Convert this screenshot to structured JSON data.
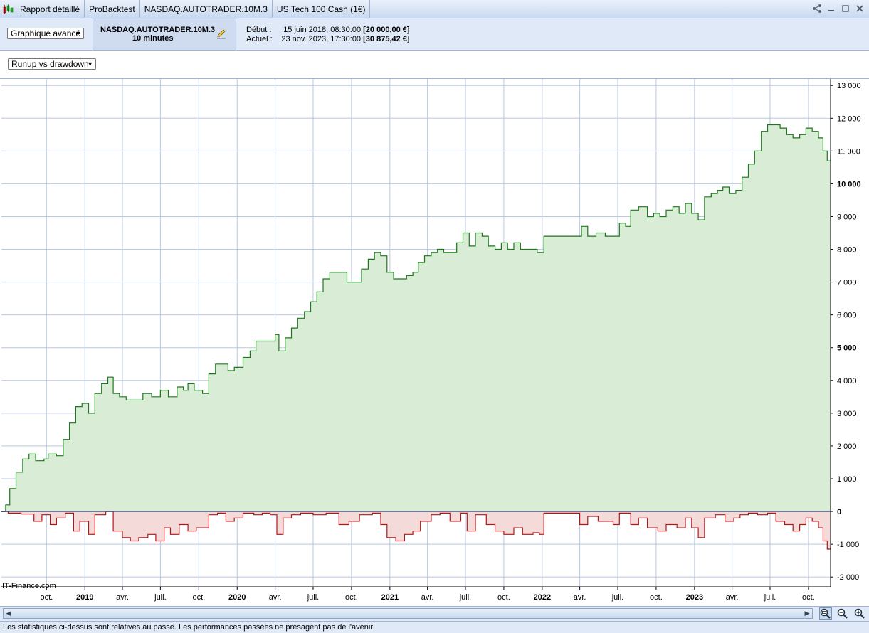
{
  "tabs": [
    "Rapport détaillé",
    "ProBacktest",
    "NASDAQ.AUTOTRADER.10M.3",
    "US Tech 100 Cash (1€)"
  ],
  "header": {
    "view_select": "Graphique avancé",
    "system_name": "NASDAQ.AUTOTRADER.10M.3",
    "timeframe": "10 minutes",
    "start_label": "Début :",
    "start_date": "15 juin 2018, 08:30:00",
    "start_capital": "[20 000,00 €]",
    "current_label": "Actuel :",
    "current_date": "23 nov. 2023, 17:30:00",
    "current_capital": "[30 875,42 €]"
  },
  "chart_select": "Runup vs drawdown",
  "watermark": "IT-Finance.com",
  "status_text": "Les statistiques ci-dessus sont relatives au passé. Les performances passées ne présagent pas de l'avenir.",
  "chart_data": {
    "type": "area",
    "xlabel": "",
    "ylabel": "",
    "ylim": [
      -2300,
      13200
    ],
    "yticks": [
      {
        "v": 13000,
        "label": "13 000",
        "bold": false
      },
      {
        "v": 12000,
        "label": "12 000",
        "bold": false
      },
      {
        "v": 11000,
        "label": "11 000",
        "bold": false
      },
      {
        "v": 10000,
        "label": "10 000",
        "bold": true
      },
      {
        "v": 9000,
        "label": "9 000",
        "bold": false
      },
      {
        "v": 8000,
        "label": "8 000",
        "bold": false
      },
      {
        "v": 7000,
        "label": "7 000",
        "bold": false
      },
      {
        "v": 6000,
        "label": "6 000",
        "bold": false
      },
      {
        "v": 5000,
        "label": "5 000",
        "bold": true
      },
      {
        "v": 4000,
        "label": "4 000",
        "bold": false
      },
      {
        "v": 3000,
        "label": "3 000",
        "bold": false
      },
      {
        "v": 2000,
        "label": "2 000",
        "bold": false
      },
      {
        "v": 1000,
        "label": "1 000",
        "bold": false
      },
      {
        "v": 0,
        "label": "0",
        "bold": true
      },
      {
        "v": -1000,
        "label": "-1 000",
        "bold": false
      },
      {
        "v": -2000,
        "label": "-2 000",
        "bold": false
      }
    ],
    "xrange": [
      "2018-06-15",
      "2023-11-23"
    ],
    "xticks": [
      {
        "d": "2018-10-01",
        "label": "oct.",
        "bold": false
      },
      {
        "d": "2019-01-01",
        "label": "2019",
        "bold": true
      },
      {
        "d": "2019-04-01",
        "label": "avr.",
        "bold": false
      },
      {
        "d": "2019-07-01",
        "label": "juil.",
        "bold": false
      },
      {
        "d": "2019-10-01",
        "label": "oct.",
        "bold": false
      },
      {
        "d": "2020-01-01",
        "label": "2020",
        "bold": true
      },
      {
        "d": "2020-04-01",
        "label": "avr.",
        "bold": false
      },
      {
        "d": "2020-07-01",
        "label": "juil.",
        "bold": false
      },
      {
        "d": "2020-10-01",
        "label": "oct.",
        "bold": false
      },
      {
        "d": "2021-01-01",
        "label": "2021",
        "bold": true
      },
      {
        "d": "2021-04-01",
        "label": "avr.",
        "bold": false
      },
      {
        "d": "2021-07-01",
        "label": "juil.",
        "bold": false
      },
      {
        "d": "2021-10-01",
        "label": "oct.",
        "bold": false
      },
      {
        "d": "2022-01-01",
        "label": "2022",
        "bold": true
      },
      {
        "d": "2022-04-01",
        "label": "avr.",
        "bold": false
      },
      {
        "d": "2022-07-01",
        "label": "juil.",
        "bold": false
      },
      {
        "d": "2022-10-01",
        "label": "oct.",
        "bold": false
      },
      {
        "d": "2023-01-01",
        "label": "2023",
        "bold": true
      },
      {
        "d": "2023-04-01",
        "label": "avr.",
        "bold": false
      },
      {
        "d": "2023-07-01",
        "label": "juil.",
        "bold": false
      },
      {
        "d": "2023-10-01",
        "label": "oct.",
        "bold": false
      }
    ],
    "grid": true,
    "colors": {
      "runup_line": "#1a7a1a",
      "runup_fill": "#d8ecd6",
      "drawdown_line": "#b01818",
      "drawdown_fill": "#f5dada",
      "grid": "#b8c8e0"
    },
    "series": [
      {
        "key": "runup",
        "points": [
          [
            "2018-06-15",
            0
          ],
          [
            "2018-06-25",
            200
          ],
          [
            "2018-07-05",
            700
          ],
          [
            "2018-07-20",
            1200
          ],
          [
            "2018-08-05",
            1600
          ],
          [
            "2018-08-20",
            1750
          ],
          [
            "2018-09-05",
            1550
          ],
          [
            "2018-09-25",
            1600
          ],
          [
            "2018-10-05",
            1750
          ],
          [
            "2018-10-25",
            1700
          ],
          [
            "2018-11-10",
            2200
          ],
          [
            "2018-11-25",
            2700
          ],
          [
            "2018-12-10",
            3200
          ],
          [
            "2018-12-25",
            3300
          ],
          [
            "2019-01-10",
            3000
          ],
          [
            "2019-01-25",
            3600
          ],
          [
            "2019-02-10",
            3900
          ],
          [
            "2019-02-25",
            4100
          ],
          [
            "2019-03-10",
            3600
          ],
          [
            "2019-03-25",
            3500
          ],
          [
            "2019-04-10",
            3400
          ],
          [
            "2019-05-01",
            3400
          ],
          [
            "2019-05-20",
            3600
          ],
          [
            "2019-06-10",
            3500
          ],
          [
            "2019-07-01",
            3700
          ],
          [
            "2019-07-20",
            3500
          ],
          [
            "2019-08-10",
            3800
          ],
          [
            "2019-08-25",
            3700
          ],
          [
            "2019-09-05",
            3900
          ],
          [
            "2019-09-20",
            3700
          ],
          [
            "2019-10-10",
            3600
          ],
          [
            "2019-10-25",
            4200
          ],
          [
            "2019-11-10",
            4500
          ],
          [
            "2019-11-25",
            4500
          ],
          [
            "2019-12-10",
            4300
          ],
          [
            "2019-12-25",
            4400
          ],
          [
            "2020-01-15",
            4700
          ],
          [
            "2020-02-01",
            4900
          ],
          [
            "2020-02-15",
            5200
          ],
          [
            "2020-03-05",
            5200
          ],
          [
            "2020-03-25",
            5200
          ],
          [
            "2020-04-01",
            5400
          ],
          [
            "2020-04-10",
            4900
          ],
          [
            "2020-04-25",
            5300
          ],
          [
            "2020-05-10",
            5600
          ],
          [
            "2020-05-25",
            5900
          ],
          [
            "2020-06-10",
            6100
          ],
          [
            "2020-06-25",
            6400
          ],
          [
            "2020-07-10",
            6700
          ],
          [
            "2020-07-25",
            7100
          ],
          [
            "2020-08-10",
            7300
          ],
          [
            "2020-09-01",
            7300
          ],
          [
            "2020-09-20",
            7000
          ],
          [
            "2020-10-10",
            7000
          ],
          [
            "2020-10-25",
            7400
          ],
          [
            "2020-11-10",
            7700
          ],
          [
            "2020-11-25",
            7900
          ],
          [
            "2020-12-10",
            7800
          ],
          [
            "2020-12-25",
            7300
          ],
          [
            "2021-01-10",
            7100
          ],
          [
            "2021-01-25",
            7100
          ],
          [
            "2021-02-10",
            7200
          ],
          [
            "2021-02-25",
            7300
          ],
          [
            "2021-03-10",
            7600
          ],
          [
            "2021-03-25",
            7800
          ],
          [
            "2021-04-10",
            7900
          ],
          [
            "2021-04-25",
            8000
          ],
          [
            "2021-05-10",
            7900
          ],
          [
            "2021-05-25",
            7900
          ],
          [
            "2021-06-10",
            8200
          ],
          [
            "2021-06-25",
            8500
          ],
          [
            "2021-07-10",
            8100
          ],
          [
            "2021-07-25",
            8500
          ],
          [
            "2021-08-10",
            8400
          ],
          [
            "2021-08-25",
            8100
          ],
          [
            "2021-09-10",
            8000
          ],
          [
            "2021-09-25",
            8200
          ],
          [
            "2021-10-10",
            8000
          ],
          [
            "2021-10-25",
            8200
          ],
          [
            "2021-11-10",
            8000
          ],
          [
            "2021-12-01",
            8000
          ],
          [
            "2021-12-20",
            7900
          ],
          [
            "2022-01-05",
            8400
          ],
          [
            "2022-02-01",
            8400
          ],
          [
            "2022-03-01",
            8400
          ],
          [
            "2022-03-25",
            8400
          ],
          [
            "2022-04-05",
            8700
          ],
          [
            "2022-04-20",
            8400
          ],
          [
            "2022-05-10",
            8500
          ],
          [
            "2022-06-01",
            8400
          ],
          [
            "2022-06-25",
            8400
          ],
          [
            "2022-07-05",
            8800
          ],
          [
            "2022-07-20",
            8700
          ],
          [
            "2022-08-01",
            9200
          ],
          [
            "2022-08-20",
            9300
          ],
          [
            "2022-09-10",
            9000
          ],
          [
            "2022-09-25",
            9100
          ],
          [
            "2022-10-10",
            9000
          ],
          [
            "2022-10-25",
            9200
          ],
          [
            "2022-11-10",
            9300
          ],
          [
            "2022-11-25",
            9100
          ],
          [
            "2022-12-10",
            9400
          ],
          [
            "2022-12-25",
            9100
          ],
          [
            "2023-01-10",
            8900
          ],
          [
            "2023-01-25",
            9600
          ],
          [
            "2023-02-10",
            9700
          ],
          [
            "2023-02-25",
            9800
          ],
          [
            "2023-03-10",
            9900
          ],
          [
            "2023-03-25",
            9700
          ],
          [
            "2023-04-10",
            9800
          ],
          [
            "2023-04-25",
            10200
          ],
          [
            "2023-05-10",
            10600
          ],
          [
            "2023-05-25",
            11000
          ],
          [
            "2023-06-10",
            11600
          ],
          [
            "2023-06-25",
            11800
          ],
          [
            "2023-07-10",
            11800
          ],
          [
            "2023-07-25",
            11700
          ],
          [
            "2023-08-10",
            11500
          ],
          [
            "2023-08-25",
            11400
          ],
          [
            "2023-09-10",
            11500
          ],
          [
            "2023-09-25",
            11700
          ],
          [
            "2023-10-10",
            11600
          ],
          [
            "2023-10-25",
            11400
          ],
          [
            "2023-11-05",
            11000
          ],
          [
            "2023-11-15",
            10700
          ],
          [
            "2023-11-23",
            10875
          ]
        ]
      },
      {
        "key": "drawdown",
        "points": [
          [
            "2018-06-15",
            0
          ],
          [
            "2018-07-01",
            -50
          ],
          [
            "2018-08-01",
            -80
          ],
          [
            "2018-09-01",
            -300
          ],
          [
            "2018-09-20",
            -100
          ],
          [
            "2018-10-10",
            -400
          ],
          [
            "2018-10-25",
            -200
          ],
          [
            "2018-11-15",
            -50
          ],
          [
            "2018-12-05",
            -600
          ],
          [
            "2018-12-20",
            -300
          ],
          [
            "2019-01-10",
            -700
          ],
          [
            "2019-01-25",
            -100
          ],
          [
            "2019-02-20",
            0
          ],
          [
            "2019-03-10",
            -600
          ],
          [
            "2019-04-01",
            -800
          ],
          [
            "2019-04-20",
            -900
          ],
          [
            "2019-05-10",
            -800
          ],
          [
            "2019-06-01",
            -700
          ],
          [
            "2019-06-20",
            -900
          ],
          [
            "2019-07-10",
            -500
          ],
          [
            "2019-07-25",
            -700
          ],
          [
            "2019-08-15",
            -400
          ],
          [
            "2019-09-05",
            -600
          ],
          [
            "2019-09-25",
            -500
          ],
          [
            "2019-10-10",
            -500
          ],
          [
            "2019-10-25",
            -100
          ],
          [
            "2019-11-15",
            -50
          ],
          [
            "2019-12-05",
            -300
          ],
          [
            "2019-12-25",
            -200
          ],
          [
            "2020-01-15",
            -50
          ],
          [
            "2020-02-10",
            -100
          ],
          [
            "2020-03-01",
            -50
          ],
          [
            "2020-03-20",
            -100
          ],
          [
            "2020-04-05",
            -700
          ],
          [
            "2020-04-20",
            -200
          ],
          [
            "2020-05-10",
            -100
          ],
          [
            "2020-06-01",
            -50
          ],
          [
            "2020-07-01",
            -100
          ],
          [
            "2020-08-01",
            -50
          ],
          [
            "2020-09-01",
            -400
          ],
          [
            "2020-09-25",
            -300
          ],
          [
            "2020-10-20",
            -100
          ],
          [
            "2020-11-20",
            -50
          ],
          [
            "2020-12-10",
            -400
          ],
          [
            "2020-12-25",
            -800
          ],
          [
            "2021-01-15",
            -900
          ],
          [
            "2021-02-05",
            -700
          ],
          [
            "2021-02-25",
            -600
          ],
          [
            "2021-03-15",
            -300
          ],
          [
            "2021-04-10",
            -100
          ],
          [
            "2021-05-01",
            -50
          ],
          [
            "2021-05-25",
            -300
          ],
          [
            "2021-06-20",
            -50
          ],
          [
            "2021-07-05",
            -600
          ],
          [
            "2021-07-25",
            -100
          ],
          [
            "2021-08-20",
            -400
          ],
          [
            "2021-09-10",
            -600
          ],
          [
            "2021-10-01",
            -700
          ],
          [
            "2021-10-25",
            -500
          ],
          [
            "2021-11-15",
            -700
          ],
          [
            "2021-12-10",
            -650
          ],
          [
            "2021-12-25",
            -700
          ],
          [
            "2022-01-05",
            -50
          ],
          [
            "2022-03-10",
            -50
          ],
          [
            "2022-04-01",
            -400
          ],
          [
            "2022-04-20",
            -150
          ],
          [
            "2022-05-15",
            -300
          ],
          [
            "2022-06-20",
            -400
          ],
          [
            "2022-07-05",
            -50
          ],
          [
            "2022-08-01",
            -400
          ],
          [
            "2022-08-20",
            -200
          ],
          [
            "2022-09-10",
            -500
          ],
          [
            "2022-10-05",
            -600
          ],
          [
            "2022-10-25",
            -400
          ],
          [
            "2022-11-20",
            -500
          ],
          [
            "2022-12-10",
            -200
          ],
          [
            "2022-12-25",
            -500
          ],
          [
            "2023-01-10",
            -800
          ],
          [
            "2023-01-25",
            -200
          ],
          [
            "2023-02-20",
            -100
          ],
          [
            "2023-03-15",
            -300
          ],
          [
            "2023-04-05",
            -200
          ],
          [
            "2023-04-20",
            -100
          ],
          [
            "2023-05-10",
            -50
          ],
          [
            "2023-06-01",
            -100
          ],
          [
            "2023-06-25",
            -50
          ],
          [
            "2023-07-15",
            -300
          ],
          [
            "2023-08-05",
            -400
          ],
          [
            "2023-08-25",
            -600
          ],
          [
            "2023-09-10",
            -400
          ],
          [
            "2023-09-25",
            -200
          ],
          [
            "2023-10-10",
            -300
          ],
          [
            "2023-10-25",
            -500
          ],
          [
            "2023-11-05",
            -900
          ],
          [
            "2023-11-15",
            -1150
          ],
          [
            "2023-11-23",
            -1100
          ]
        ]
      }
    ]
  }
}
